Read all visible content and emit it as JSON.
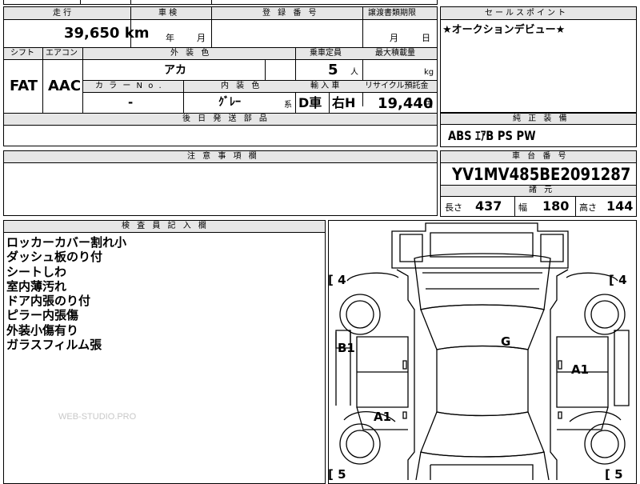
{
  "header_row": {
    "mileage_label": "走 行",
    "inspection_label": "車 検",
    "registration_label": "登 録 番 号",
    "transfer_deadline_label": "譲渡書類期限",
    "sales_point_label": "セールスポイント"
  },
  "mileage": {
    "value": "39,650",
    "unit": "km"
  },
  "inspection": {
    "year_unit": "年",
    "month_unit": "月"
  },
  "transfer": {
    "month_unit": "月",
    "day_unit": "日"
  },
  "sales_point": "★オークションデビュー★",
  "row2_labels": {
    "shift": "シフト",
    "aircon": "エアコン",
    "exterior_color": "外 装 色",
    "capacity": "乗車定員",
    "max_load": "最大積載量"
  },
  "shift": "FAT",
  "aircon": "AAC",
  "exterior_color": "アカ",
  "capacity": {
    "value": "5",
    "unit": "人"
  },
  "max_load": {
    "value": "",
    "unit": "kg"
  },
  "row3_labels": {
    "color_no": "カ ラ ー N o .",
    "interior_color": "内 装 色",
    "import": "輸 入 車",
    "recycle": "リサイクル預託金"
  },
  "color_no": "-",
  "interior_color": {
    "value": "ｸﾞﾚｰ",
    "suffix": "系"
  },
  "import": {
    "type": "D車",
    "steering": "右H"
  },
  "recycle": {
    "value": "19,440",
    "unit": "円"
  },
  "later_parts_label": "後 日 発 送 部 品",
  "genuine_equipment_label": "純 正 装 備",
  "genuine_equipment": "ABS ｴｱB PS PW",
  "notes_label": "注 意 事 項 欄",
  "chassis_label": "車 台 番 号",
  "chassis_number": "YV1MV485BE2091287",
  "specs_label": "諸 元",
  "specs": {
    "length_label": "長さ",
    "length": "437",
    "width_label": "幅",
    "width": "180",
    "height_label": "高さ",
    "height": "144"
  },
  "inspector_label": "検 査 員 記 入 欄",
  "inspector_notes": [
    "ロッカーカバー割れ小",
    "ダッシュ板のり付",
    "シートしわ",
    "室内薄汚れ",
    "ドア内張のり付",
    "ピラー内張傷",
    "外装小傷有り",
    "ガラスフィルム張"
  ],
  "watermark": "WEB-STUDIO.PRO",
  "diagram": {
    "front_left_tag": "[ 4",
    "front_right_tag": "[ 4",
    "rear_left_tag": "[ 5",
    "rear_right_tag": "[ 5",
    "mark_B1": "B1",
    "mark_G": "G",
    "mark_A1_right": "A1",
    "mark_A1_left": "A1"
  }
}
